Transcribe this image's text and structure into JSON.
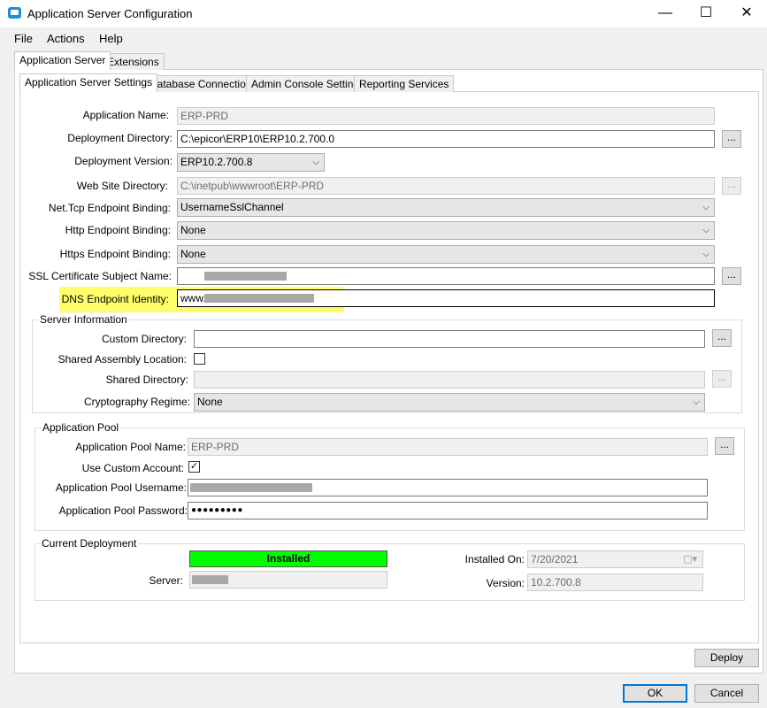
{
  "window": {
    "title": "Application Server Configuration",
    "minimize_glyph": "—",
    "maximize_glyph": "☐",
    "close_glyph": "✕"
  },
  "menu": [
    "File",
    "Actions",
    "Help"
  ],
  "top_tabs": [
    "Application Server",
    "Extensions"
  ],
  "sub_tabs": [
    "Application Server Settings",
    "Database Connection",
    "Admin Console Settings",
    "Reporting Services"
  ],
  "settings": {
    "app_name_label": "Application Name:",
    "app_name_value": "ERP-PRD",
    "deploy_dir_label": "Deployment Directory:",
    "deploy_dir_value": "C:\\epicor\\ERP10\\ERP10.2.700.0",
    "deploy_ver_label": "Deployment Version:",
    "deploy_ver_value": "ERP10.2.700.8",
    "website_dir_label": "Web Site Directory:",
    "website_dir_value": "C:\\inetpub\\wwwroot\\ERP-PRD",
    "nettcp_label": "Net.Tcp Endpoint Binding:",
    "nettcp_value": "UsernameSslChannel",
    "http_label": "Http Endpoint Binding:",
    "http_value": "None",
    "https_label": "Https Endpoint Binding:",
    "https_value": "None",
    "ssl_label": "SSL Certificate Subject Name:",
    "dns_label": "DNS Endpoint Identity:",
    "dns_value": "www."
  },
  "server_info": {
    "legend": "Server Information",
    "custom_dir_label": "Custom Directory:",
    "custom_dir_value": "",
    "shared_asm_label": "Shared Assembly Location:",
    "shared_asm_checked": false,
    "shared_dir_label": "Shared Directory:",
    "shared_dir_value": "",
    "crypto_label": "Cryptography Regime:",
    "crypto_value": "None"
  },
  "app_pool": {
    "legend": "Application Pool",
    "pool_name_label": "Application Pool Name:",
    "pool_name_value": "ERP-PRD",
    "custom_account_label": "Use Custom Account:",
    "custom_account_checked": true,
    "username_label": "Application Pool Username:",
    "password_label": "Application Pool Password:",
    "password_value": "●●●●●●●●●"
  },
  "deployment": {
    "legend": "Current Deployment",
    "status": "Installed",
    "status_color": "#00ff00",
    "server_label": "Server:",
    "installed_on_label": "Installed On:",
    "installed_on_value": "7/20/2021",
    "version_label": "Version:",
    "version_value": "10.2.700.8"
  },
  "buttons": {
    "browse": "...",
    "deploy": "Deploy",
    "ok": "OK",
    "cancel": "Cancel"
  },
  "colors": {
    "highlight": "#ffff6b",
    "default_button_border": "#0078d7"
  }
}
